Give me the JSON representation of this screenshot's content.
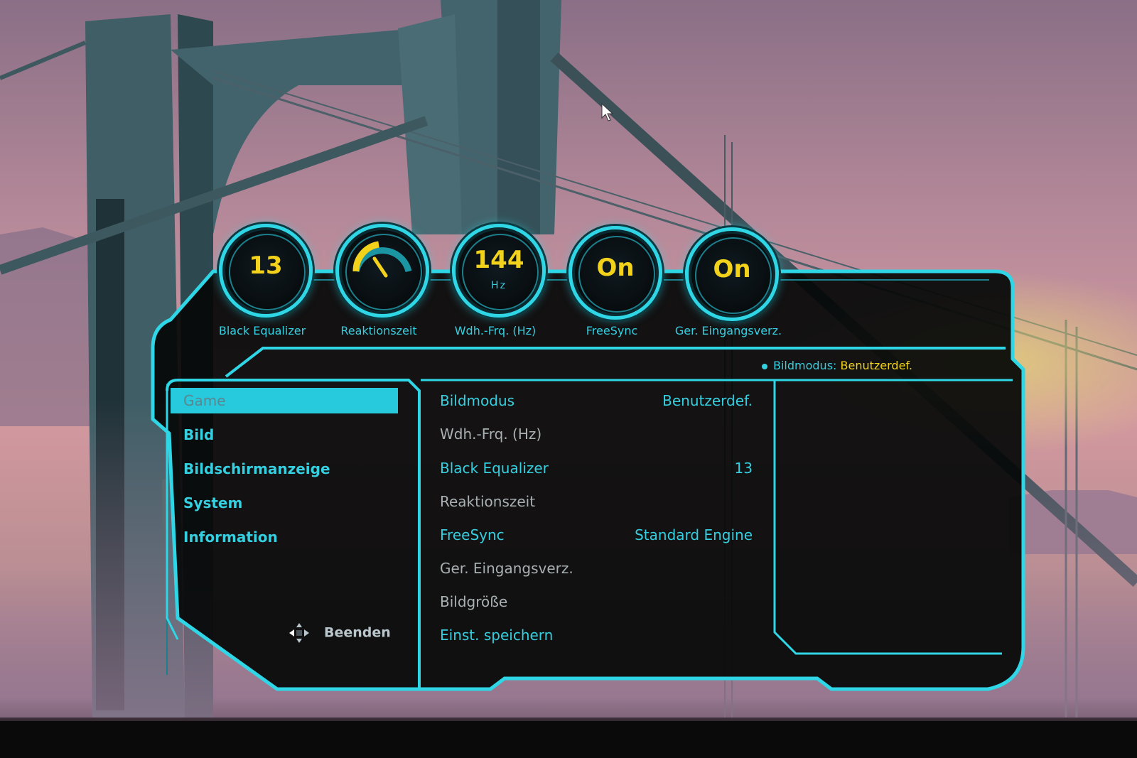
{
  "gauges": [
    {
      "value": "13",
      "unit": "",
      "label": "Black Equalizer"
    },
    {
      "value": "",
      "unit": "",
      "label": "Reaktionszeit",
      "icon": "speedometer-icon"
    },
    {
      "value": "144",
      "unit": "Hz",
      "label": "Wdh.-Frq. (Hz)"
    },
    {
      "value": "On",
      "unit": "",
      "label": "FreeSync"
    },
    {
      "value": "On",
      "unit": "",
      "label": "Ger. Eingangsverz."
    }
  ],
  "status": {
    "label": "Bildmodus:",
    "value": "Benutzerdef."
  },
  "menu": {
    "items": [
      {
        "label": "Game",
        "active": true
      },
      {
        "label": "Bild",
        "active": false
      },
      {
        "label": "Bildschirmanzeige",
        "active": false
      },
      {
        "label": "System",
        "active": false
      },
      {
        "label": "Information",
        "active": false
      }
    ],
    "exit_label": "Beenden"
  },
  "settings": [
    {
      "label": "Bildmodus",
      "value": "Benutzerdef.",
      "enabled": true
    },
    {
      "label": "Wdh.-Frq. (Hz)",
      "value": "",
      "enabled": false
    },
    {
      "label": "Black Equalizer",
      "value": "13",
      "enabled": true
    },
    {
      "label": "Reaktionszeit",
      "value": "",
      "enabled": false
    },
    {
      "label": "FreeSync",
      "value": "Standard Engine",
      "enabled": true
    },
    {
      "label": "Ger. Eingangsverz.",
      "value": "",
      "enabled": false
    },
    {
      "label": "Bildgröße",
      "value": "",
      "enabled": false
    },
    {
      "label": "Einst. speichern",
      "value": "",
      "enabled": true
    }
  ],
  "colors": {
    "accent": "#35cfe0",
    "value": "#f2d21a",
    "panel": "#050708"
  }
}
